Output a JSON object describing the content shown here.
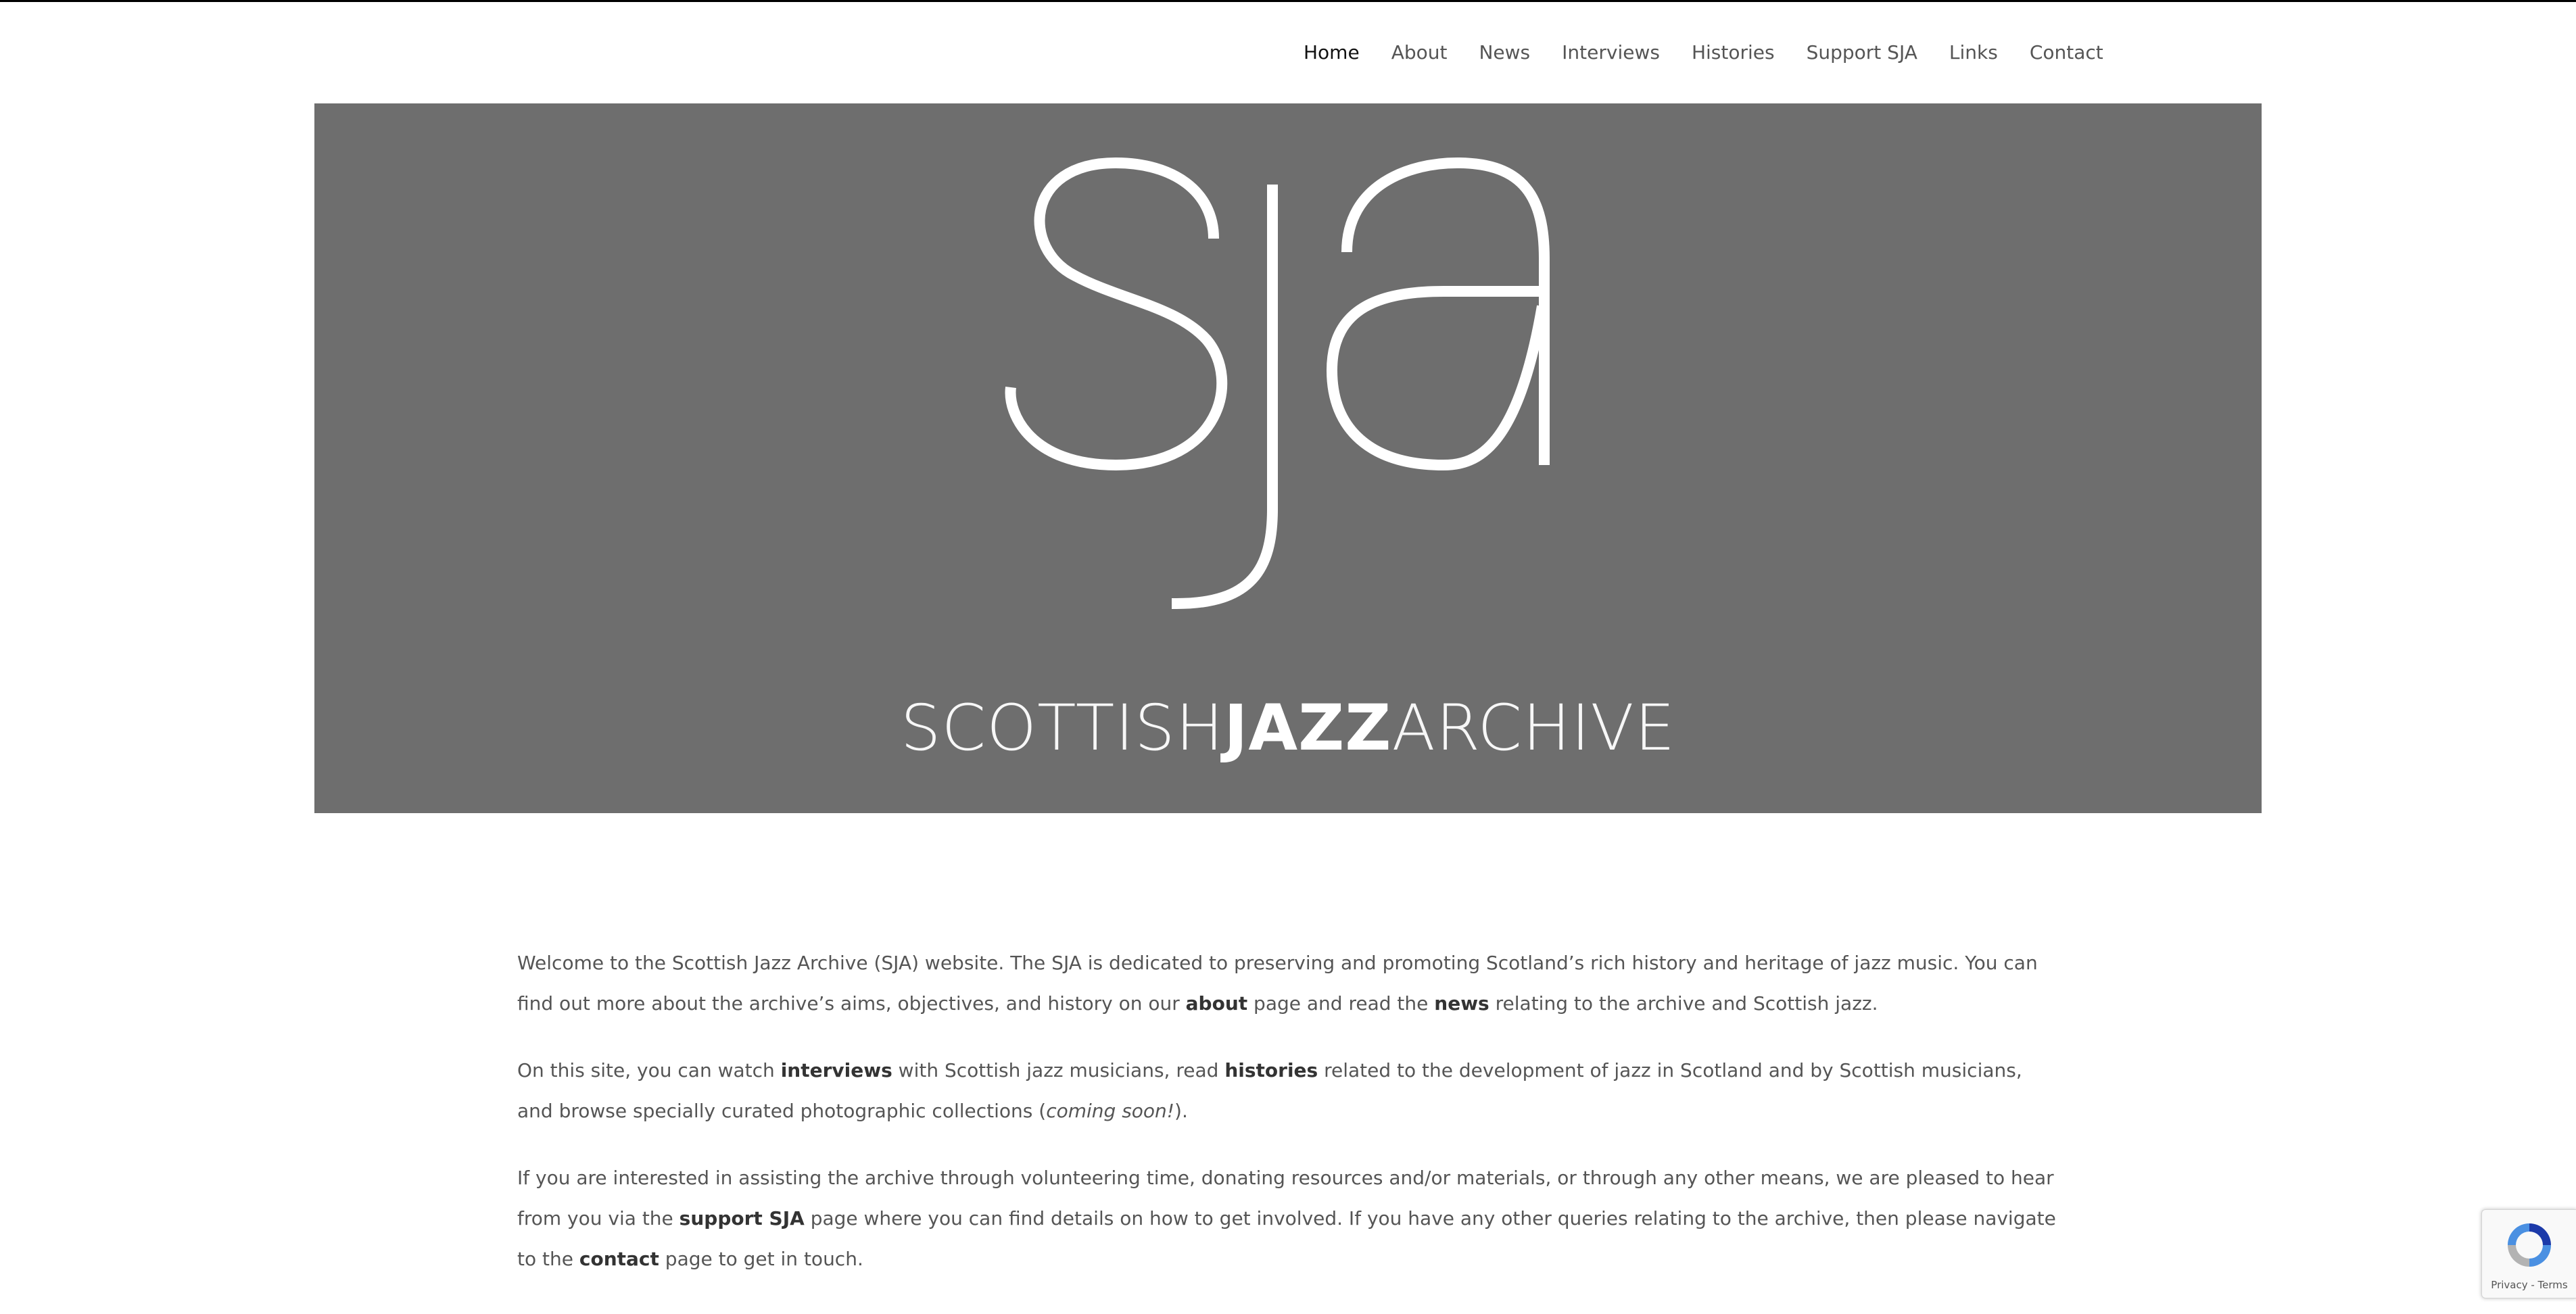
{
  "nav": {
    "items": [
      {
        "label": "Home"
      },
      {
        "label": "About"
      },
      {
        "label": "News"
      },
      {
        "label": "Interviews"
      },
      {
        "label": "Histories"
      },
      {
        "label": "Support SJA"
      },
      {
        "label": "Links"
      },
      {
        "label": "Contact"
      }
    ]
  },
  "banner": {
    "logo_letters": "sja",
    "wordmark_part1": "SCOTTISH",
    "wordmark_part2": "JAZZ",
    "wordmark_part3": "ARCHIVE"
  },
  "content": {
    "p1": {
      "t1": "Welcome to the Scottish Jazz Archive (SJA) website. The SJA is dedicated to preserving and promoting Scotland’s rich history and heritage of jazz music. You can find out more about the archive’s aims, objectives, and history on our ",
      "b1": "about",
      "t2": " page and read the ",
      "b2": "news",
      "t3": " relating to the archive and Scottish jazz."
    },
    "p2": {
      "t1": "On this site, you can watch ",
      "b1": "interviews",
      "t2": " with Scottish jazz musicians, read ",
      "b2": "histories",
      "t3": " related to the development of jazz in Scotland and by Scottish musicians, and browse specially curated photographic collections (",
      "i1": "coming soon!",
      "t4": ")."
    },
    "p3": {
      "t1": "If you are interested in assisting the archive through volunteering time, donating resources and/or materials, or through any other means, we are pleased to hear from you via the ",
      "b1": "support SJA",
      "t2": " page where you can find details on how to get involved. If you have any other queries relating to the archive, then please navigate to the ",
      "b2": "contact",
      "t3": " page to get in touch."
    }
  },
  "recaptcha": {
    "terms": "Privacy - Terms",
    "icon": "recaptcha-icon"
  },
  "colors": {
    "banner_bg": "#6e6e6e",
    "text": "#555555",
    "logo": "#ffffff"
  }
}
